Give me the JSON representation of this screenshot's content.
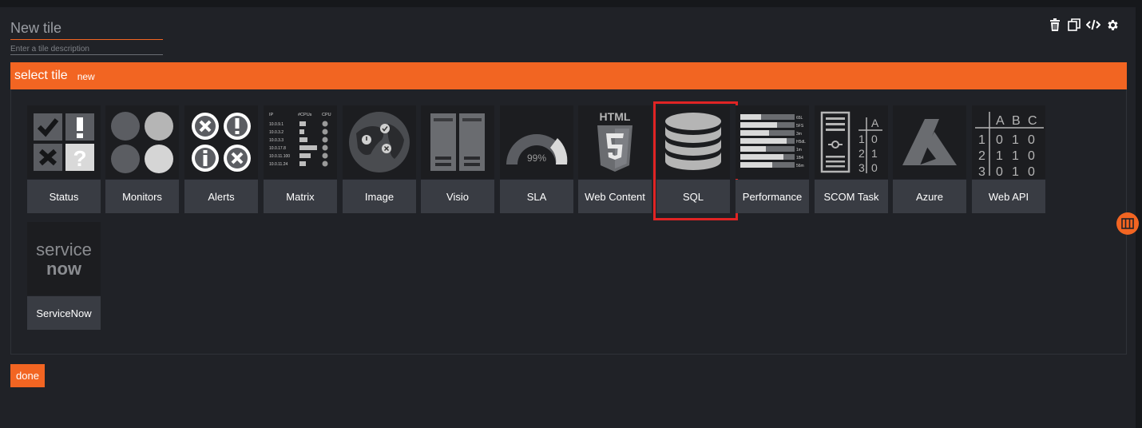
{
  "tile_editor": {
    "title_placeholder": "New tile",
    "description_placeholder": "Enter a tile description"
  },
  "toolbar": {
    "icons": [
      "trash-icon",
      "duplicate-icon",
      "code-icon",
      "gear-icon"
    ]
  },
  "header": {
    "title": "select tile",
    "new_label": "new"
  },
  "tiles": [
    {
      "label": "Status"
    },
    {
      "label": "Monitors"
    },
    {
      "label": "Alerts"
    },
    {
      "label": "Matrix",
      "matrix_headers": [
        "IP",
        "#CPUs",
        "CPU"
      ],
      "matrix_rows": [
        "10.0.9.1",
        "10.0.3.2",
        "10.0.3.3",
        "10.0.17.8",
        "10.0.11.100",
        "10.0.11.24"
      ]
    },
    {
      "label": "Image"
    },
    {
      "label": "Visio"
    },
    {
      "label": "SLA",
      "gauge_text": "99%"
    },
    {
      "label": "Web Content",
      "icon_text": "HTML"
    },
    {
      "label": "SQL",
      "selected": true
    },
    {
      "label": "Performance",
      "bar_labels": [
        "65L",
        "5FS",
        "3m",
        "H5dL",
        "1m",
        "1B4",
        "56m"
      ]
    },
    {
      "label": "SCOM Task",
      "icon_text": [
        "A",
        "1",
        "0",
        "2",
        "1",
        "3",
        "0"
      ]
    },
    {
      "label": "Azure"
    },
    {
      "label": "Web API",
      "grid_headers": [
        "A",
        "B",
        "C"
      ],
      "grid_rows": [
        [
          "1",
          "0",
          "1",
          "0"
        ],
        [
          "2",
          "1",
          "1",
          "0"
        ],
        [
          "3",
          "0",
          "1",
          "0"
        ]
      ]
    },
    {
      "label": "ServiceNow",
      "logo_text": [
        "service",
        "now"
      ]
    }
  ],
  "footer": {
    "done_label": "done"
  },
  "colors": {
    "accent": "#f26522",
    "background": "#202227",
    "tile_icon_bg": "#1c1d20",
    "tile_label_bg": "#393c43",
    "selection": "#e02424"
  }
}
